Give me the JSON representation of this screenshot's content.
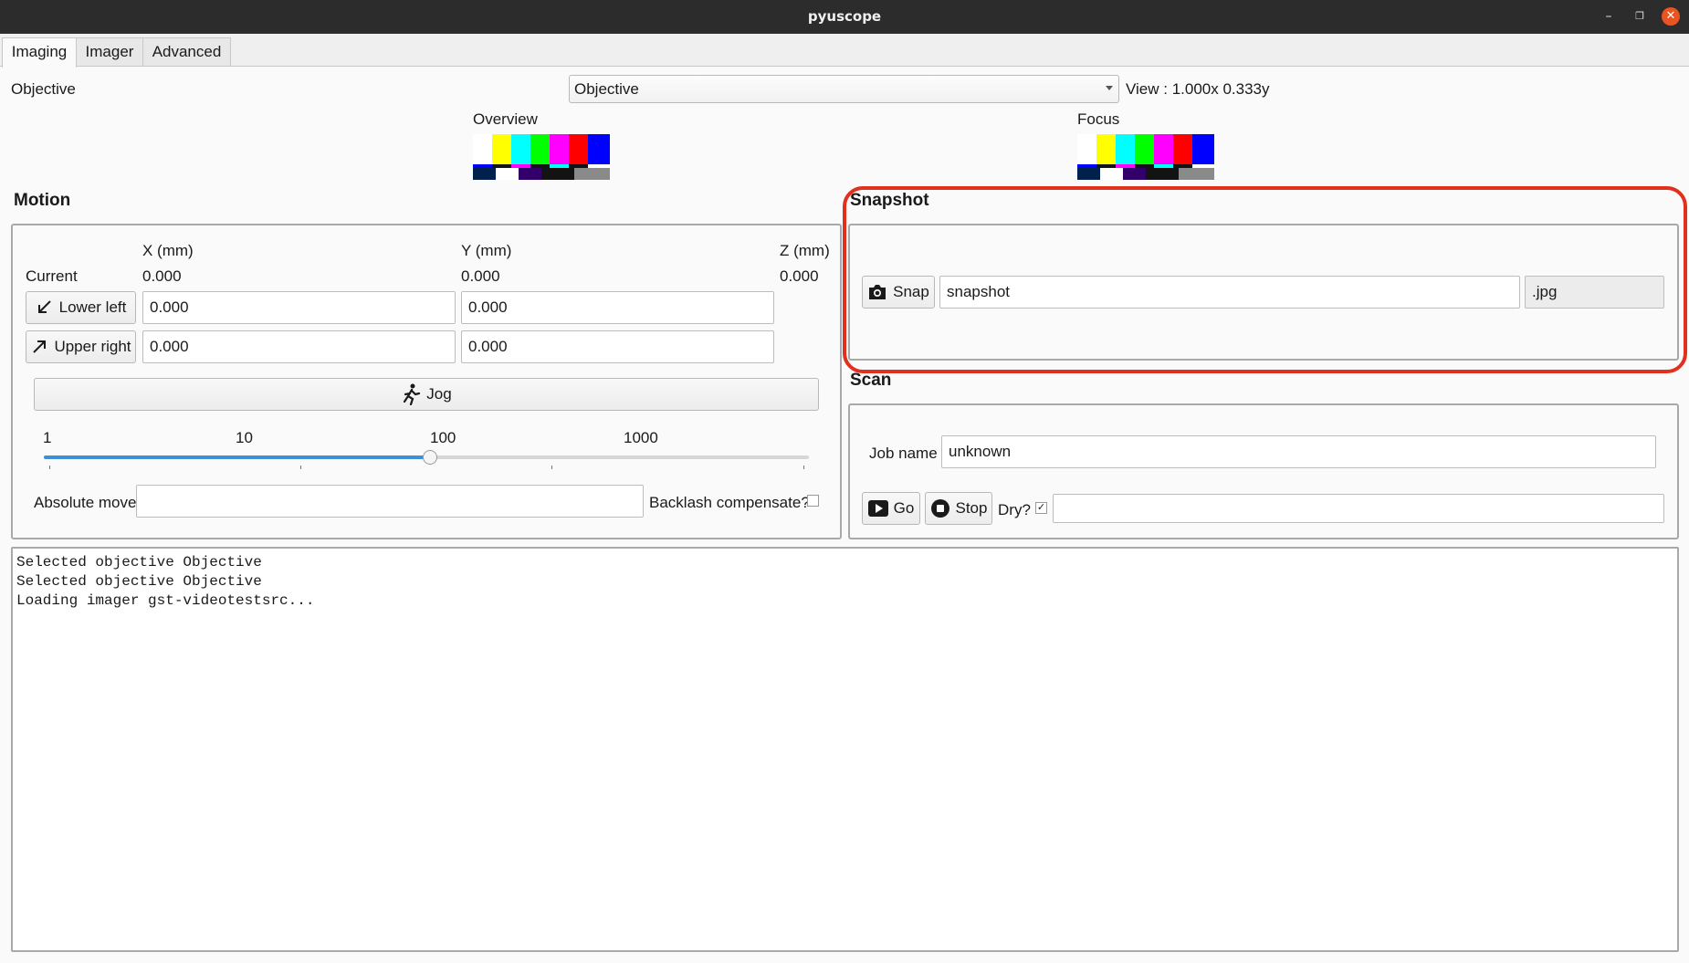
{
  "window": {
    "title": "pyuscope"
  },
  "tabs": [
    {
      "label": "Imaging",
      "active": true
    },
    {
      "label": "Imager"
    },
    {
      "label": "Advanced"
    }
  ],
  "objective": {
    "label": "Objective",
    "selected": "Objective",
    "view": "View : 1.000x 0.333y"
  },
  "previews": {
    "overview_label": "Overview",
    "focus_label": "Focus"
  },
  "motion": {
    "title": "Motion",
    "headers": {
      "x": "X (mm)",
      "y": "Y (mm)",
      "z": "Z (mm)"
    },
    "current": {
      "label": "Current",
      "x": "0.000",
      "y": "0.000",
      "z": "0.000"
    },
    "lower_left": {
      "label": "Lower left",
      "x": "0.000",
      "y": "0.000"
    },
    "upper_right": {
      "label": "Upper right",
      "x": "0.000",
      "y": "0.000"
    },
    "jog": {
      "label": "Jog"
    },
    "slider": {
      "labels": [
        "1",
        "10",
        "100",
        "1000"
      ],
      "value": 100
    },
    "absolute_move": {
      "label": "Absolute move",
      "value": ""
    },
    "backlash": {
      "label": "Backlash compensate?",
      "checked": false
    }
  },
  "snapshot": {
    "title": "Snapshot",
    "snap_label": "Snap",
    "filename": "snapshot",
    "extension": ".jpg"
  },
  "scan": {
    "title": "Scan",
    "job_name_label": "Job name",
    "job_name": "unknown",
    "go_label": "Go",
    "stop_label": "Stop",
    "dry_label": "Dry?",
    "dry_checked": true,
    "status": ""
  },
  "log": {
    "lines": [
      "Selected objective Objective",
      "Selected objective Objective",
      "Loading imager gst-videotestsrc..."
    ]
  },
  "colors": {
    "accent": "#3d8fd8",
    "highlight": "#e0301e"
  }
}
